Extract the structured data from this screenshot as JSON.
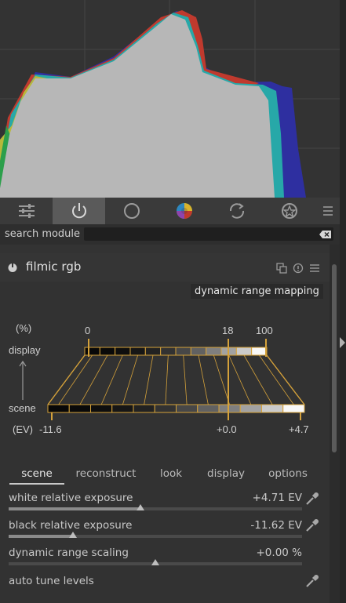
{
  "histogram": {
    "name": "histogram"
  },
  "toolbar": {
    "buttons": [
      {
        "name": "presets-icon"
      },
      {
        "name": "power-icon"
      },
      {
        "name": "circle-icon"
      },
      {
        "name": "color-wheel-icon"
      },
      {
        "name": "refresh-icon"
      },
      {
        "name": "effects-icon"
      },
      {
        "name": "menu-icon"
      }
    ]
  },
  "search": {
    "label": "search module",
    "value": "",
    "placeholder": ""
  },
  "module": {
    "title": "filmic rgb"
  },
  "graph": {
    "title": "dynamic range mapping",
    "percent_label": "(%)",
    "display_label": "display",
    "scene_label": "scene",
    "ev_label": "(EV)",
    "display_ticks": [
      "0",
      "18",
      "100"
    ],
    "scene_ticks": [
      "-11.6",
      "+0.0",
      "+4.7"
    ]
  },
  "tabs": {
    "items": [
      "scene",
      "reconstruct",
      "look",
      "display",
      "options"
    ],
    "active": "scene"
  },
  "sliders": {
    "white": {
      "label": "white relative exposure",
      "value": "+4.71 EV",
      "position": 0.45
    },
    "black": {
      "label": "black relative exposure",
      "value": "-11.62 EV",
      "position": 0.22
    },
    "range": {
      "label": "dynamic range scaling",
      "value": "+0.00 %",
      "position": 0.5
    }
  },
  "auto_tune": {
    "label": "auto tune levels"
  },
  "colors": {
    "accent": "#d4a13a",
    "background": "#333333"
  }
}
